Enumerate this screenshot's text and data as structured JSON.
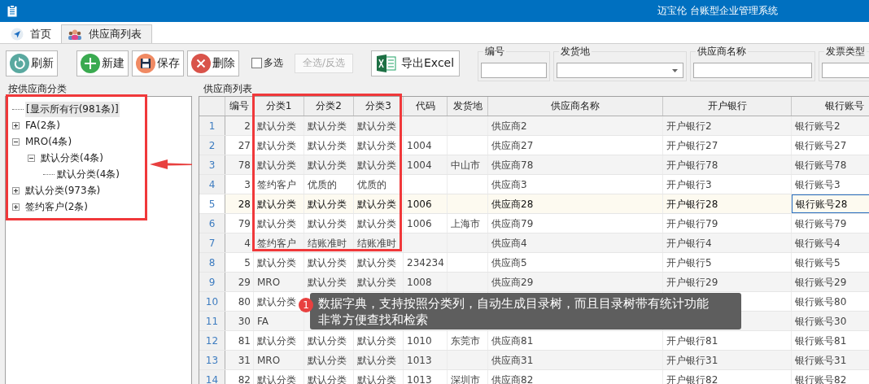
{
  "window": {
    "title": "迈宝伦 台账型企业管理系统"
  },
  "tabs": [
    {
      "label": "首页",
      "selected": false
    },
    {
      "label": "供应商列表",
      "selected": true
    }
  ],
  "toolbar": {
    "refresh": "刷新",
    "new": "新建",
    "save": "保存",
    "delete": "删除",
    "multi_select": {
      "label": "多选",
      "checked": false
    },
    "select_all": {
      "label": "全选/反选",
      "disabled": true
    },
    "export": "导出Excel"
  },
  "filters": [
    {
      "label": "编号",
      "kind": "input"
    },
    {
      "label": "发货地",
      "kind": "dropdown"
    },
    {
      "label": "供应商名称",
      "kind": "input"
    },
    {
      "label": "发票类型",
      "kind": "input"
    }
  ],
  "sidebar": {
    "title": "按供应商分类",
    "tree": [
      {
        "label": "[显示所有行(981条)]",
        "selected": true,
        "expandable": false
      },
      {
        "label": "FA(2条)",
        "selected": false,
        "expandable": true,
        "expanded": false
      },
      {
        "label": "MRO(4条)",
        "selected": false,
        "expandable": true,
        "expanded": true,
        "children": [
          {
            "label": "默认分类(4条)",
            "selected": false,
            "expandable": true,
            "expanded": true,
            "children": [
              {
                "label": "默认分类(4条)",
                "selected": false,
                "expandable": false
              }
            ]
          }
        ]
      },
      {
        "label": "默认分类(973条)",
        "selected": false,
        "expandable": true,
        "expanded": false
      },
      {
        "label": "签约客户(2条)",
        "selected": false,
        "expandable": true,
        "expanded": false
      }
    ]
  },
  "table": {
    "title": "供应商列表",
    "columns": [
      "编号",
      "分类1",
      "分类2",
      "分类3",
      "代码",
      "发货地",
      "供应商名称",
      "开户银行",
      "银行账号"
    ],
    "rows": [
      {
        "number": "1",
        "selected": false,
        "cells": [
          "2",
          "默认分类",
          "默认分类",
          "默认分类",
          null,
          null,
          "供应商2",
          "开户银行2",
          "银行账号2"
        ]
      },
      {
        "number": "2",
        "selected": false,
        "cells": [
          "27",
          "默认分类",
          "默认分类",
          "默认分类",
          "1004",
          null,
          "供应商27",
          "开户银行27",
          "银行账号27"
        ]
      },
      {
        "number": "3",
        "selected": false,
        "cells": [
          "78",
          "默认分类",
          "默认分类",
          "默认分类",
          "1004",
          "中山市",
          "供应商78",
          "开户银行78",
          "银行账号78"
        ]
      },
      {
        "number": "4",
        "selected": false,
        "cells": [
          "3",
          "签约客户",
          "优质的",
          "优质的",
          null,
          null,
          "供应商3",
          "开户银行3",
          "银行账号3"
        ]
      },
      {
        "number": "5",
        "selected": true,
        "cells": [
          "28",
          "默认分类",
          "默认分类",
          "默认分类",
          "1006",
          null,
          "供应商28",
          "开户银行28",
          "银行账号28"
        ]
      },
      {
        "number": "6",
        "selected": false,
        "cells": [
          "79",
          "默认分类",
          "默认分类",
          "默认分类",
          "1006",
          "上海市",
          "供应商79",
          "开户银行79",
          "银行账号79"
        ]
      },
      {
        "number": "7",
        "selected": false,
        "cells": [
          "4",
          "签约客户",
          "结账准时",
          "结账准时",
          null,
          null,
          "供应商4",
          "开户银行4",
          "银行账号4"
        ]
      },
      {
        "number": "8",
        "selected": false,
        "cells": [
          "5",
          "默认分类",
          "默认分类",
          "默认分类",
          "234234",
          null,
          "供应商5",
          "开户银行5",
          "银行账号5"
        ]
      },
      {
        "number": "9",
        "selected": false,
        "cells": [
          "29",
          "MRO",
          "默认分类",
          "默认分类",
          "1008",
          null,
          "供应商29",
          "开户银行29",
          "银行账号29"
        ]
      },
      {
        "number": "10",
        "selected": false,
        "cells": [
          "80",
          "默认分类",
          null,
          null,
          null,
          null,
          null,
          null,
          "银行账号80"
        ]
      },
      {
        "number": "11",
        "selected": false,
        "cells": [
          "30",
          "FA",
          null,
          null,
          null,
          null,
          null,
          null,
          "银行账号30"
        ]
      },
      {
        "number": "12",
        "selected": false,
        "cells": [
          "81",
          "默认分类",
          "默认分类",
          "默认分类",
          "1010",
          "东莞市",
          "供应商81",
          "开户银行81",
          "银行账号81"
        ]
      },
      {
        "number": "13",
        "selected": false,
        "cells": [
          "31",
          "MRO",
          "默认分类",
          "默认分类",
          "1013",
          null,
          "供应商31",
          "开户银行31",
          "银行账号31"
        ]
      },
      {
        "number": "14",
        "selected": false,
        "cells": [
          "82",
          "默认分类",
          "默认分类",
          "默认分类",
          "1013",
          "深圳市",
          "供应商82",
          "开户银行82",
          "银行账号82"
        ]
      }
    ]
  },
  "callout": {
    "number": "1",
    "text": "数据字典，支持按照分类列，自动生成目录树，而且目录树带有统计功能非常方便查找和检索"
  }
}
